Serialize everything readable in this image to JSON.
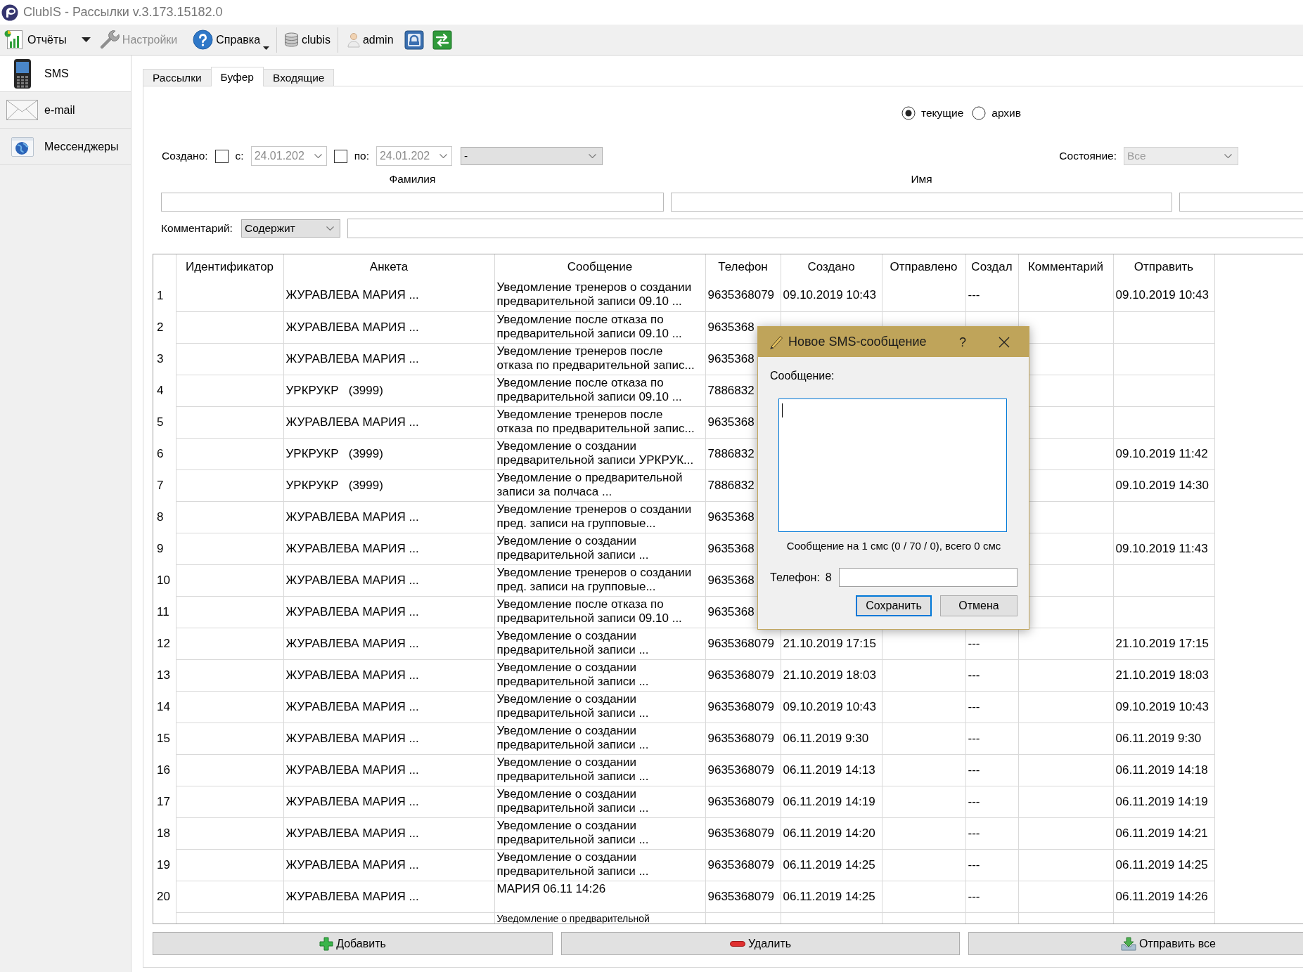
{
  "window": {
    "title": "ClubIS - Рассылки v.3.173.15182.0"
  },
  "toolbar": {
    "groups": [
      {
        "items": [
          {
            "kind": "text",
            "label": "Отчёты",
            "disabled": false,
            "menu_button": true
          },
          {
            "kind": "text",
            "label": "Настройки",
            "disabled": true
          },
          {
            "kind": "text",
            "label": "Справка",
            "disabled": false,
            "menu_indicator": true
          }
        ]
      },
      {
        "items": [
          {
            "kind": "text",
            "label": "clubis",
            "disabled": false
          }
        ]
      },
      {
        "items": [
          {
            "kind": "text",
            "label": "admin",
            "disabled": false
          },
          {
            "kind": "icon",
            "disabled": false
          },
          {
            "kind": "icon",
            "disabled": false
          }
        ]
      }
    ]
  },
  "sidebar": {
    "items": [
      {
        "label": "SMS",
        "selected": true
      },
      {
        "label": "e-mail",
        "selected": false
      },
      {
        "label": "Мессенджеры",
        "selected": false
      }
    ]
  },
  "tabs": [
    {
      "label": "Рассылки",
      "selected": false
    },
    {
      "label": "Буфер",
      "selected": true
    },
    {
      "label": "Входящие",
      "selected": false
    }
  ],
  "filters": {
    "period": [
      {
        "label": "текущие",
        "selected": true
      },
      {
        "label": "архив",
        "selected": false
      }
    ],
    "created_label": "Создано:",
    "from": {
      "label": "с:",
      "checked": false,
      "value": "24.01.202",
      "disabled": true
    },
    "to": {
      "label": "по:",
      "checked": false,
      "value": "24.01.202",
      "disabled": true
    },
    "preset": {
      "value": "-"
    },
    "state": {
      "label": "Состояние:",
      "value": "Все",
      "disabled": true
    },
    "fields": [
      {
        "label": "Фамилия"
      },
      {
        "label": "Имя"
      }
    ],
    "comment": {
      "label": "Комментарий:",
      "mode": "Содержит"
    }
  },
  "table": {
    "columns": [
      "Идентификатор",
      "Анкета",
      "Сообщение",
      "Телефон",
      "Создано",
      "Отправлено",
      "Создал",
      "Комментарий",
      "Отправить"
    ],
    "rows": [
      {
        "index": "1",
        "form": "ЖУРАВЛЕВА МАРИЯ ...",
        "message": "Уведомление тренеров о создании\nпредварительной записи 09.10 ...",
        "phone": "9635368079",
        "created": "09.10.2019 10:43",
        "created_by": "---",
        "send_at": "09.10.2019 10:43"
      },
      {
        "index": "2",
        "form": "ЖУРАВЛЕВА МАРИЯ ...",
        "message": "Уведомление после отказа по\nпредварительной записи 09.10 ...",
        "phone": "9635368"
      },
      {
        "index": "3",
        "form": "ЖУРАВЛЕВА МАРИЯ ...",
        "message": "Уведомление тренеров после\nотказа по предварительной запис...",
        "phone": "9635368"
      },
      {
        "index": "4",
        "form": "УРКРУКР   (3999)",
        "message": "Уведомление после отказа по\nпредварительной записи 09.10 ...",
        "phone": "7886832"
      },
      {
        "index": "5",
        "form": "ЖУРАВЛЕВА МАРИЯ ...",
        "message": "Уведомление тренеров после\nотказа по предварительной запис...",
        "phone": "9635368"
      },
      {
        "index": "6",
        "form": "УРКРУКР   (3999)",
        "message": "Уведомление о создании\nпредварительной записи УРКРУК...",
        "phone": "7886832",
        "send_at": "09.10.2019 11:42"
      },
      {
        "index": "7",
        "form": "УРКРУКР   (3999)",
        "message": "Уведомление о предварительной\nзаписи за полчаса ...",
        "phone": "7886832",
        "send_at": "09.10.2019 14:30"
      },
      {
        "index": "8",
        "form": "ЖУРАВЛЕВА МАРИЯ ...",
        "message": "Уведомление тренеров о создании\nпред. записи на групповые...",
        "phone": "9635368"
      },
      {
        "index": "9",
        "form": "ЖУРАВЛЕВА МАРИЯ ...",
        "message": "Уведомление о создании\nпредварительной записи ...",
        "phone": "9635368",
        "send_at": "09.10.2019 11:43"
      },
      {
        "index": "10",
        "form": "ЖУРАВЛЕВА МАРИЯ ...",
        "message": "Уведомление тренеров о создании\nпред. записи на групповые...",
        "phone": "9635368"
      },
      {
        "index": "11",
        "form": "ЖУРАВЛЕВА МАРИЯ ...",
        "message": "Уведомление после отказа по\nпредварительной записи 09.10 ...",
        "phone": "9635368"
      },
      {
        "index": "12",
        "form": "ЖУРАВЛЕВА МАРИЯ ...",
        "message": "Уведомление о создании\nпредварительной записи ...",
        "phone": "9635368079",
        "created": "21.10.2019 17:15",
        "created_by": "---",
        "send_at": "21.10.2019 17:15"
      },
      {
        "index": "13",
        "form": "ЖУРАВЛЕВА МАРИЯ ...",
        "message": "Уведомление о создании\nпредварительной записи ...",
        "phone": "9635368079",
        "created": "21.10.2019 18:03",
        "created_by": "---",
        "send_at": "21.10.2019 18:03"
      },
      {
        "index": "14",
        "form": "ЖУРАВЛЕВА МАРИЯ ...",
        "message": "Уведомление о создании\nпредварительной записи ...",
        "phone": "9635368079",
        "created": "09.10.2019 10:43",
        "created_by": "---",
        "send_at": "09.10.2019 10:43"
      },
      {
        "index": "15",
        "form": "ЖУРАВЛЕВА МАРИЯ ...",
        "message": "Уведомление о создании\nпредварительной записи ...",
        "phone": "9635368079",
        "created": "06.11.2019 9:30",
        "created_by": "---",
        "send_at": "06.11.2019 9:30"
      },
      {
        "index": "16",
        "form": "ЖУРАВЛЕВА МАРИЯ ...",
        "message": "Уведомление о создании\nпредварительной записи ...",
        "phone": "9635368079",
        "created": "06.11.2019 14:13",
        "created_by": "---",
        "send_at": "06.11.2019 14:18"
      },
      {
        "index": "17",
        "form": "ЖУРАВЛЕВА МАРИЯ ...",
        "message": "Уведомление о создании\nпредварительной записи ...",
        "phone": "9635368079",
        "created": "06.11.2019 14:19",
        "created_by": "---",
        "send_at": "06.11.2019 14:19"
      },
      {
        "index": "18",
        "form": "ЖУРАВЛЕВА МАРИЯ ...",
        "message": "Уведомление о создании\nпредварительной записи ...",
        "phone": "9635368079",
        "created": "06.11.2019 14:20",
        "created_by": "---",
        "send_at": "06.11.2019 14:21"
      },
      {
        "index": "19",
        "form": "ЖУРАВЛЕВА МАРИЯ ...",
        "message": "Уведомление о создании\nпредварительной записи ...",
        "phone": "9635368079",
        "created": "06.11.2019 14:25",
        "created_by": "---",
        "send_at": "06.11.2019 14:25"
      },
      {
        "index": "20",
        "form": "ЖУРАВЛЕВА МАРИЯ ...",
        "message": "МАРИЯ 06.11 14:26",
        "phone": "9635368079",
        "created": "06.11.2019 14:25",
        "created_by": "---",
        "send_at": "06.11.2019 14:26"
      },
      {
        "message": "Уведомление о предварительной"
      }
    ]
  },
  "actions": [
    {
      "label": "Добавить"
    },
    {
      "label": "Удалить"
    },
    {
      "label": "Отправить все"
    }
  ],
  "dialog": {
    "title": "Новое SMS-сообщение",
    "help": "?",
    "message_label": "Сообщение:",
    "message": {
      "focused": true
    },
    "counter": "Сообщение на 1 смс (0 / 70 / 0), всего 0 смс",
    "phone_label": "Телефон:",
    "phone_prefix": "8",
    "buttons": [
      {
        "label": "Сохранить",
        "default": true
      },
      {
        "label": "Отмена",
        "default": false
      }
    ]
  }
}
